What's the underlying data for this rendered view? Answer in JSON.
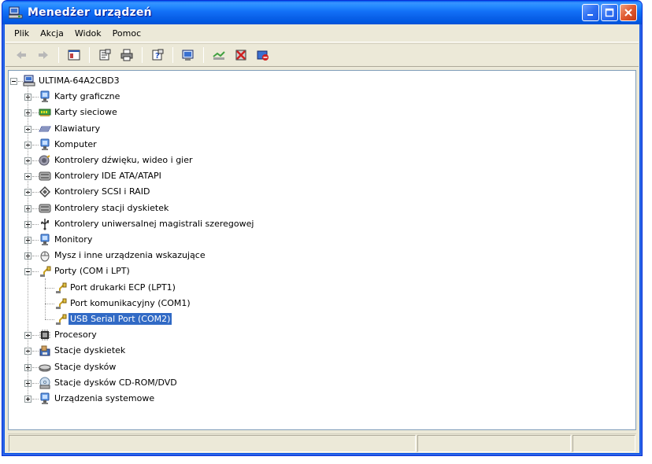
{
  "window": {
    "title": "Menedżer urządzeń"
  },
  "menu": [
    {
      "label": "Plik"
    },
    {
      "label": "Akcja"
    },
    {
      "label": "Widok"
    },
    {
      "label": "Pomoc"
    }
  ],
  "toolbar": {
    "buttons": [
      "back-icon",
      "forward-icon",
      "console-tree-icon",
      "properties-icon",
      "print-icon",
      "help-icon",
      "scan-hardware-icon",
      "update-driver-icon",
      "uninstall-icon",
      "disable-icon"
    ]
  },
  "tree": {
    "root": "ULTIMA-64A2CBD3",
    "categories": [
      {
        "label": "Karty graficzne",
        "icon": "monitor-icon",
        "expanded": false
      },
      {
        "label": "Karty sieciowe",
        "icon": "network-card-icon",
        "expanded": false
      },
      {
        "label": "Klawiatury",
        "icon": "keyboard-icon",
        "expanded": false
      },
      {
        "label": "Komputer",
        "icon": "computer-icon",
        "expanded": false
      },
      {
        "label": "Kontrolery dźwięku, wideo i gier",
        "icon": "sound-icon",
        "expanded": false
      },
      {
        "label": "Kontrolery IDE ATA/ATAPI",
        "icon": "ide-icon",
        "expanded": false
      },
      {
        "label": "Kontrolery SCSI i RAID",
        "icon": "scsi-icon",
        "expanded": false
      },
      {
        "label": "Kontrolery stacji dyskietek",
        "icon": "floppy-controller-icon",
        "expanded": false
      },
      {
        "label": "Kontrolery uniwersalnej magistrali szeregowej",
        "icon": "usb-icon",
        "expanded": false
      },
      {
        "label": "Monitory",
        "icon": "monitor-icon",
        "expanded": false
      },
      {
        "label": "Mysz i inne urządzenia wskazujące",
        "icon": "mouse-icon",
        "expanded": false
      },
      {
        "label": "Porty (COM i LPT)",
        "icon": "port-icon",
        "expanded": true,
        "children": [
          {
            "label": "Port drukarki ECP (LPT1)",
            "icon": "port-icon"
          },
          {
            "label": "Port komunikacyjny (COM1)",
            "icon": "port-icon"
          },
          {
            "label": "USB Serial Port (COM2)",
            "icon": "port-icon",
            "selected": true
          }
        ]
      },
      {
        "label": "Procesory",
        "icon": "cpu-icon",
        "expanded": false
      },
      {
        "label": "Stacje dyskietek",
        "icon": "floppy-icon",
        "expanded": false
      },
      {
        "label": "Stacje dysków",
        "icon": "disk-icon",
        "expanded": false
      },
      {
        "label": "Stacje dysków CD-ROM/DVD",
        "icon": "cdrom-icon",
        "expanded": false
      },
      {
        "label": "Urządzenia systemowe",
        "icon": "system-device-icon",
        "expanded": false
      }
    ]
  },
  "colors": {
    "selection": "#316ac5",
    "titlebar": "#0a61e9"
  }
}
